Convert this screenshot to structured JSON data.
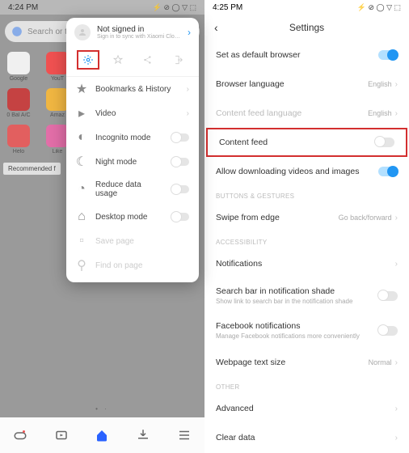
{
  "left": {
    "status_time": "4:24 PM",
    "status_icons": "⚡ ⊘ ◯ ▽ ⬚",
    "search_placeholder": "Search or ty",
    "apps_row1": [
      "Google",
      "YouT",
      "",
      "",
      ""
    ],
    "apps_row2": [
      "0 Bal A/C",
      "Amaz",
      "",
      "",
      ""
    ],
    "apps_row3": [
      "Helo",
      "Like",
      "",
      "",
      ""
    ],
    "recommended": "Recommended f",
    "page_dots": "• ·",
    "popup": {
      "user_title": "Not signed in",
      "user_sub": "Sign in to sync with Xiaomi Clo…",
      "menu": [
        {
          "label": "Bookmarks & History",
          "icon": "star"
        },
        {
          "label": "Video",
          "icon": "play"
        },
        {
          "label": "Incognito mode",
          "icon": "mask"
        },
        {
          "label": "Night mode",
          "icon": "moon"
        },
        {
          "label": "Reduce data usage",
          "icon": "gauge"
        },
        {
          "label": "Desktop mode",
          "icon": "desktop"
        },
        {
          "label": "Save page",
          "icon": "save"
        },
        {
          "label": "Find on page",
          "icon": "search"
        }
      ]
    }
  },
  "right": {
    "status_time": "4:25 PM",
    "status_icons": "⚡ ⊘ ◯ ▽ ⬚",
    "title": "Settings",
    "rows": {
      "default_browser": "Set as default browser",
      "browser_lang": "Browser language",
      "browser_lang_val": "English",
      "feed_lang": "Content feed language",
      "feed_lang_val": "English",
      "content_feed": "Content feed",
      "allow_dl": "Allow downloading videos and images",
      "sec_buttons": "BUTTONS & GESTURES",
      "swipe": "Swipe from edge",
      "swipe_val": "Go back/forward",
      "sec_access": "ACCESSIBILITY",
      "notifications": "Notifications",
      "search_noti": "Search bar in notification shade",
      "search_noti_sub": "Show link to search bar in the notification shade",
      "fb_noti": "Facebook notifications",
      "fb_noti_sub": "Manage Facebook notifications more conveniently",
      "text_size": "Webpage text size",
      "text_size_val": "Normal",
      "sec_other": "OTHER",
      "advanced": "Advanced",
      "clear_data": "Clear data"
    }
  }
}
